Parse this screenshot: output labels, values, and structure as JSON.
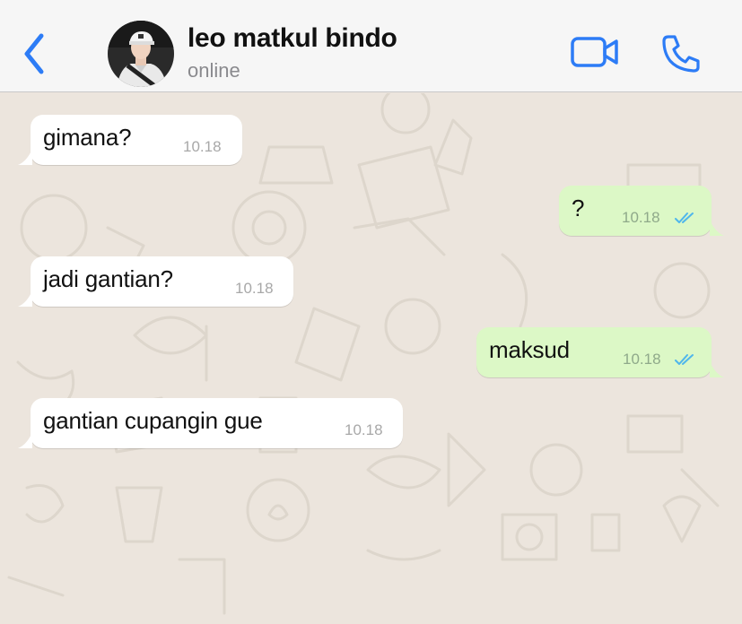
{
  "header": {
    "back_icon": "chevron-left-icon",
    "contact_name": "leo matkul bindo",
    "status": "online",
    "video_icon": "video-camera-icon",
    "call_icon": "phone-icon",
    "accent_color": "#2d7cf6"
  },
  "chat": {
    "incoming_bubble_color": "#ffffff",
    "outgoing_bubble_color": "#dcf8c6",
    "read_tick_color": "#4fb6ec",
    "messages": [
      {
        "direction": "incoming",
        "text": "gimana?",
        "time": "10.18"
      },
      {
        "direction": "outgoing",
        "text": "?",
        "time": "10.18",
        "status": "read"
      },
      {
        "direction": "incoming",
        "text": "jadi gantian?",
        "time": "10.18"
      },
      {
        "direction": "outgoing",
        "text": "maksud",
        "time": "10.18",
        "status": "read"
      },
      {
        "direction": "incoming",
        "text": "gantian cupangin gue",
        "time": "10.18"
      }
    ]
  }
}
